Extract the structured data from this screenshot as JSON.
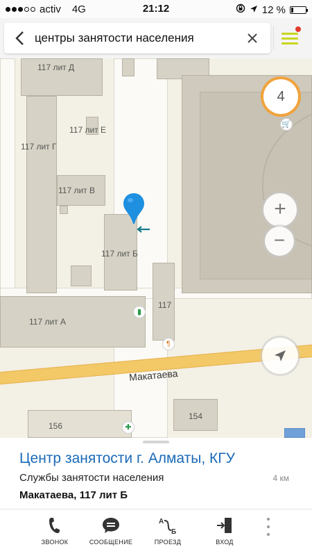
{
  "status_bar": {
    "carrier": "activ",
    "network": "4G",
    "time": "21:12",
    "battery": "12 %"
  },
  "search": {
    "query": "центры занятости населения"
  },
  "map": {
    "cluster_count": "4",
    "labels": {
      "lit_d": "117 лит Д",
      "lit_e": "117 лит Е",
      "lit_g": "117 лит Г",
      "lit_v": "117 лит В",
      "lit_b": "117 лит Б",
      "lit_a": "117 лит А",
      "b117": "117",
      "b156": "156",
      "b154": "154",
      "street": "Макатаева"
    },
    "zoom_in": "+",
    "zoom_out": "−"
  },
  "card": {
    "title": "Центр занятости г. Алматы, КГУ",
    "category": "Службы занятости населения",
    "distance": "4 км",
    "address": "Макатаева, 117 лит Б"
  },
  "actions": {
    "call": "ЗВОНОК",
    "message": "СООБЩЕНИЕ",
    "route": "ПРОЕЗД",
    "entrance": "ВХОД"
  },
  "colors": {
    "accent_blue": "#1a6ab8",
    "pin_blue": "#1f8fe0",
    "cluster_orange": "#f0a33c",
    "street_yellow": "#f3c867",
    "menu_yellow": "#c9d61e"
  }
}
